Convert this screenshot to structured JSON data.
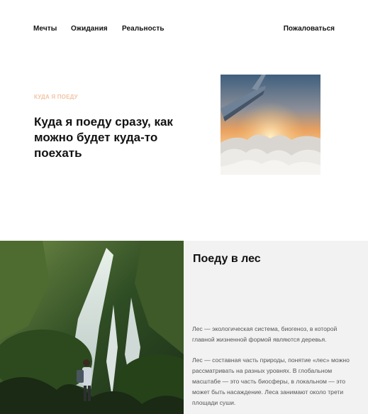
{
  "nav": {
    "items": [
      "Мечты",
      "Ожидания",
      "Реальность"
    ],
    "complain_label": "Пожаловаться"
  },
  "hero": {
    "kicker": "Куда я поеду",
    "title": "Куда я поеду сразу, как можно будет куда-то поехать",
    "image_icon": "airplane-wing-over-clouds"
  },
  "forest": {
    "title": "Поеду в лес",
    "paragraphs": [
      "Лес — экологическая система, биогеноз, в которой главной жизненной формой являются деревья.",
      "Лес — составная часть природы, понятие «лес» можно рассматривать на разных уровнях. В глобальном масштабе — это часть биосферы, в локальном — это может быть насаждение. Леса занимают около трети площади суши."
    ],
    "image_icon": "waterfall-jungle-hiker"
  },
  "colors": {
    "kicker": "#f3c3a4",
    "text_panel_bg": "#f2f2f2"
  }
}
